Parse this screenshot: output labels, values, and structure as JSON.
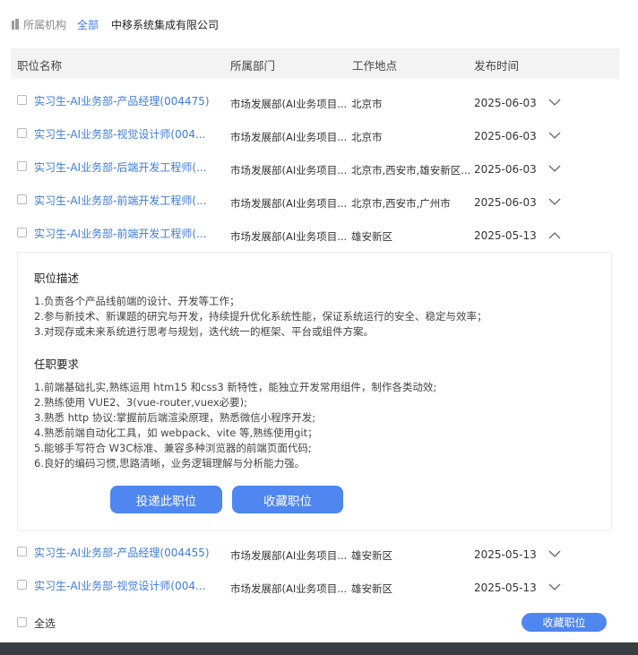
{
  "filter": {
    "label": "所属机构",
    "all_link": "全部",
    "company": "中移系统集成有限公司"
  },
  "table": {
    "headers": {
      "title": "职位名称",
      "dept": "所属部门",
      "location": "工作地点",
      "date": "发布时间"
    },
    "rows": [
      {
        "title": "实习生-AI业务部-产品经理(004475)",
        "dept": "市场发展部(AI业务项目...",
        "location": "北京市",
        "date": "2025-06-03",
        "expanded": false
      },
      {
        "title": "实习生-AI业务部-视觉设计师(004...",
        "dept": "市场发展部(AI业务项目...",
        "location": "北京市",
        "date": "2025-06-03",
        "expanded": false
      },
      {
        "title": "实习生-AI业务部-后端开发工程师(...",
        "dept": "市场发展部(AI业务项目...",
        "location": "北京市,西安市,雄安新区...",
        "date": "2025-06-03",
        "expanded": false
      },
      {
        "title": "实习生-AI业务部-前端开发工程师(...",
        "dept": "市场发展部(AI业务项目...",
        "location": "北京市,西安市,广州市",
        "date": "2025-06-03",
        "expanded": false
      },
      {
        "title": "实习生-AI业务部-前端开发工程师(...",
        "dept": "市场发展部(AI业务项目...",
        "location": "雄安新区",
        "date": "2025-05-13",
        "expanded": true
      },
      {
        "title": "实习生-AI业务部-产品经理(004455)",
        "dept": "市场发展部(AI业务项目...",
        "location": "雄安新区",
        "date": "2025-05-13",
        "expanded": false
      },
      {
        "title": "实习生-AI业务部-视觉设计师(004...",
        "dept": "市场发展部(AI业务项目...",
        "location": "雄安新区",
        "date": "2025-05-13",
        "expanded": false
      }
    ]
  },
  "detail": {
    "desc_title": "职位描述",
    "desc_lines": [
      "1.负责各个产品线前端的设计、开发等工作；",
      "2.参与新技术、新课题的研究与开发，持续提升优化系统性能，保证系统运行的安全、稳定与效率；",
      "3.对现存或未来系统进行思考与规划，迭代统一的框架、平台或组件方案。"
    ],
    "req_title": "任职要求",
    "req_lines": [
      "1.前端基础扎实,熟练运用 htm15 和css3 新特性，能独立开发常用组件，制作各类动效;",
      "2.熟练使用 VUE2、3(vue-router,vuex必要);",
      "3.熟悉 http 协议:掌握前后端渲染原理，熟悉微信小程序开发;",
      "4.熟悉前端自动化工具，如 webpack、vite 等,熟练使用git；",
      "5.能够手写符合 W3C标准、兼容多种浏览器的前端页面代码;",
      "6.良好的编码习惯,思路清晰，业务逻辑理解与分析能力强。"
    ],
    "apply_label": "投递此职位",
    "favorite_label": "收藏职位"
  },
  "footer": {
    "select_all": "全选",
    "favorite_label": "收藏职位"
  },
  "colors": {
    "link": "#3e7bdc",
    "button": "#4f86f0",
    "header_bg": "#f3f3f3"
  }
}
